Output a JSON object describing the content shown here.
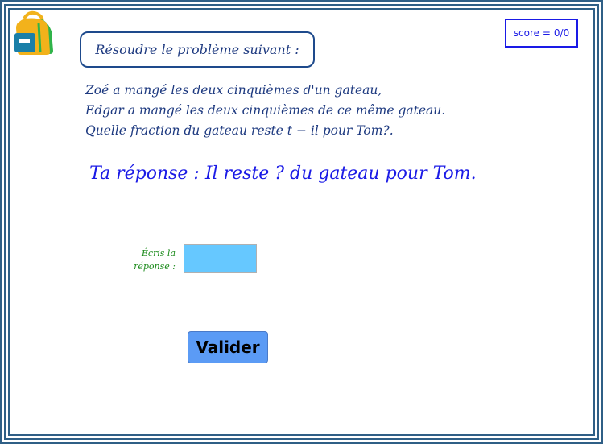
{
  "score": {
    "label": "score =",
    "value": "0/0"
  },
  "problem": {
    "heading": "Résoudre le problème suivant :",
    "lines": [
      "Zoé a mangé les deux cinquièmes d'un gateau,",
      "Edgar a mangé les deux cinquièmes de ce même gateau.",
      "Quelle fraction du gateau reste t − il pour Tom?."
    ]
  },
  "answer": {
    "sentence": "Ta réponse : Il reste ? du gateau pour Tom.",
    "label_line1": "Écris la",
    "label_line2": "réponse :",
    "input_value": ""
  },
  "actions": {
    "validate_label": "Valider"
  },
  "colors": {
    "frame": "#2f5f86",
    "score": "#1a1ae6",
    "heading_text": "#1e3a80",
    "answer_text": "#1a1ae6",
    "label_green": "#1a8a1a",
    "input_bg": "#66c8ff",
    "button_bg": "#5b9bf5"
  },
  "icons": {
    "logo": "backpack-icon"
  }
}
